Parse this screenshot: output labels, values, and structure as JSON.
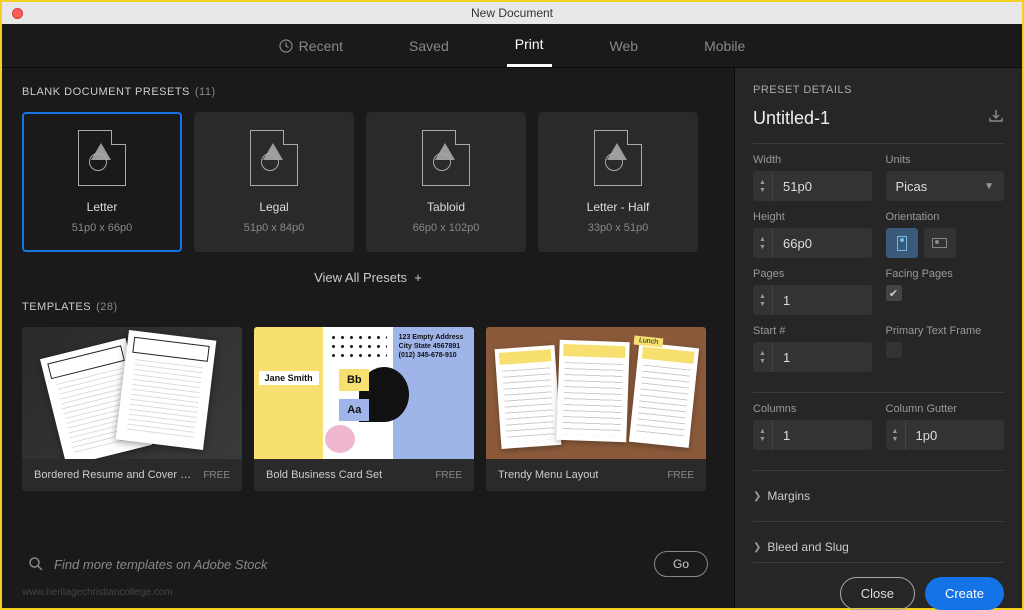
{
  "window": {
    "title": "New Document"
  },
  "tabs": {
    "recent": "Recent",
    "saved": "Saved",
    "print": "Print",
    "web": "Web",
    "mobile": "Mobile"
  },
  "presets": {
    "label": "BLANK DOCUMENT PRESETS",
    "count": "(11)",
    "items": [
      {
        "name": "Letter",
        "dim": "51p0 x 66p0"
      },
      {
        "name": "Legal",
        "dim": "51p0 x 84p0"
      },
      {
        "name": "Tabloid",
        "dim": "66p0 x 102p0"
      },
      {
        "name": "Letter - Half",
        "dim": "33p0 x 51p0"
      }
    ],
    "view_all": "View All Presets"
  },
  "templates": {
    "label": "TEMPLATES",
    "count": "(28)",
    "items": [
      {
        "name": "Bordered Resume and Cover Let...",
        "price": "FREE"
      },
      {
        "name": "Bold Business Card Set",
        "price": "FREE"
      },
      {
        "name": "Trendy Menu Layout",
        "price": "FREE"
      }
    ]
  },
  "biz_card": {
    "name": "Jane Smith",
    "addr1": "123 Empty Address",
    "addr2": "City State 4567891",
    "addr3": "(012) 345-678-910"
  },
  "menu_tag": "Lunch",
  "search": {
    "placeholder": "Find more templates on Adobe Stock",
    "go": "Go"
  },
  "watermark": "www.heritagechristiancollege.com",
  "details": {
    "title": "PRESET DETAILS",
    "docname": "Untitled-1",
    "width_label": "Width",
    "width": "51p0",
    "units_label": "Units",
    "units": "Picas",
    "height_label": "Height",
    "height": "66p0",
    "orient_label": "Orientation",
    "pages_label": "Pages",
    "pages": "1",
    "facing_label": "Facing Pages",
    "start_label": "Start #",
    "start": "1",
    "ptf_label": "Primary Text Frame",
    "cols_label": "Columns",
    "cols": "1",
    "gutter_label": "Column Gutter",
    "gutter": "1p0",
    "margins": "Margins",
    "bleed": "Bleed and Slug"
  },
  "buttons": {
    "close": "Close",
    "create": "Create"
  }
}
